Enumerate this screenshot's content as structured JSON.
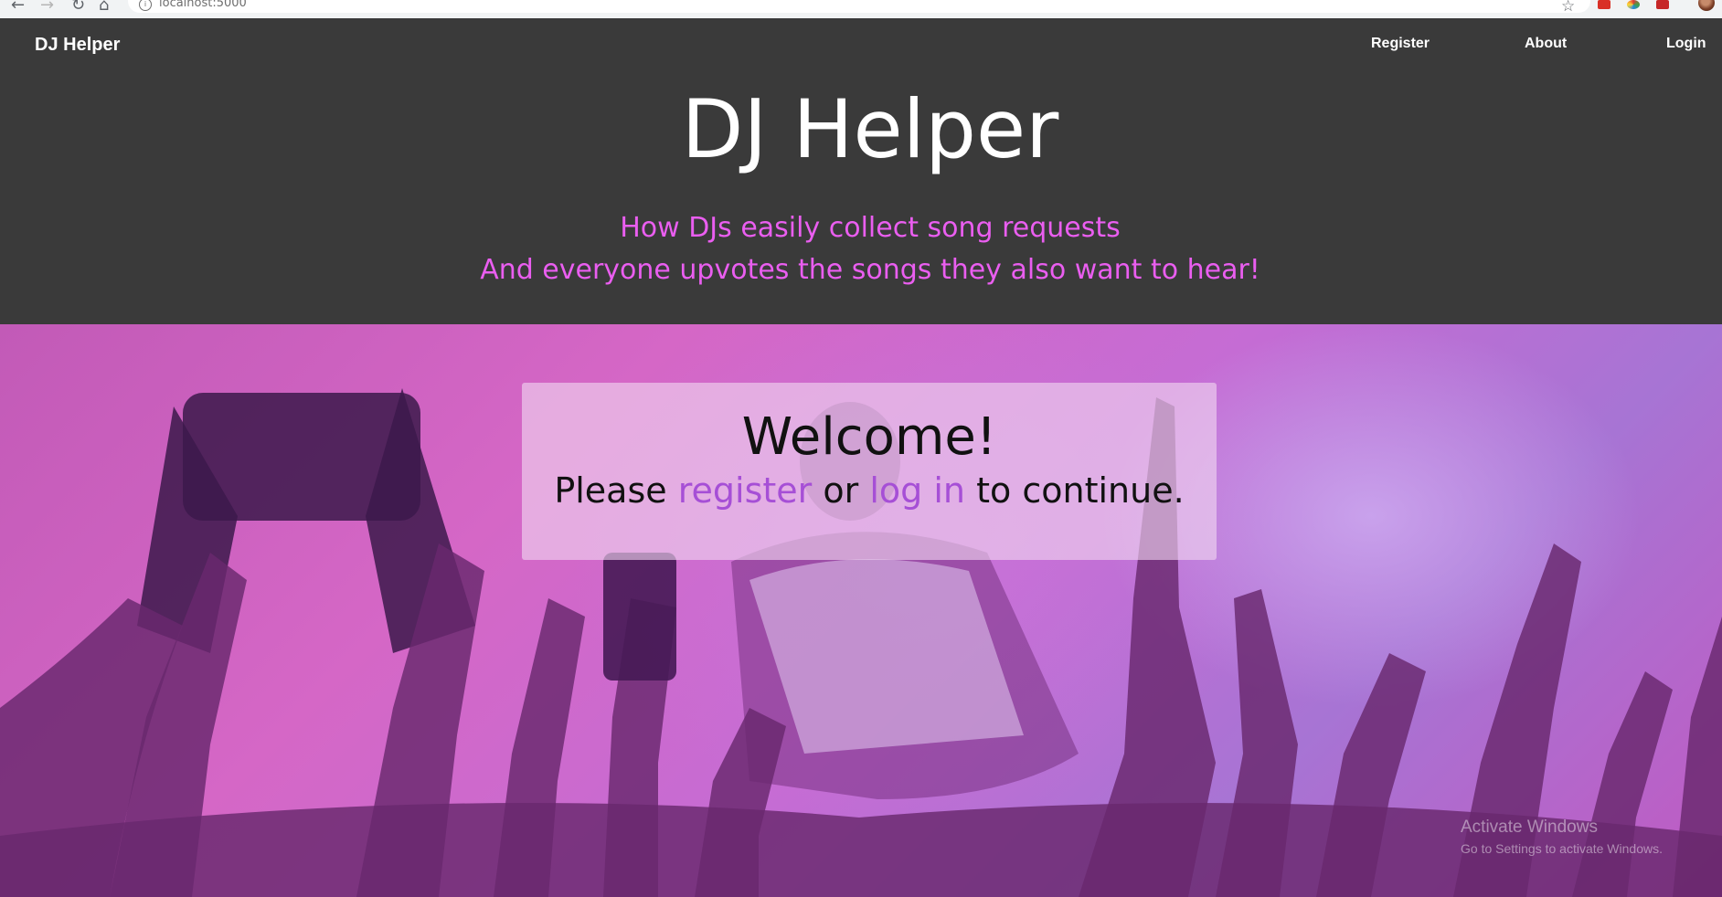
{
  "browser": {
    "url": "localhost:5000"
  },
  "navbar": {
    "brand": "DJ Helper",
    "links": [
      "Register",
      "About",
      "Login"
    ]
  },
  "hero": {
    "title": "DJ Helper",
    "tagline_lines": [
      "How DJs easily collect song requests",
      "And everyone upvotes the songs they also want to hear!"
    ]
  },
  "welcome": {
    "heading": "Welcome!",
    "prefix": "Please",
    "register_link": "register",
    "middle": "or",
    "login_link": "log in",
    "suffix": "to continue."
  },
  "watermark": {
    "title": "Activate Windows",
    "subtitle": "Go to Settings to activate Windows."
  },
  "colors": {
    "header_bg": "#3a3a3a",
    "tagline": "#ea5ef0",
    "link": "#a64fd6",
    "hero_overlay": "#c25ab7"
  }
}
